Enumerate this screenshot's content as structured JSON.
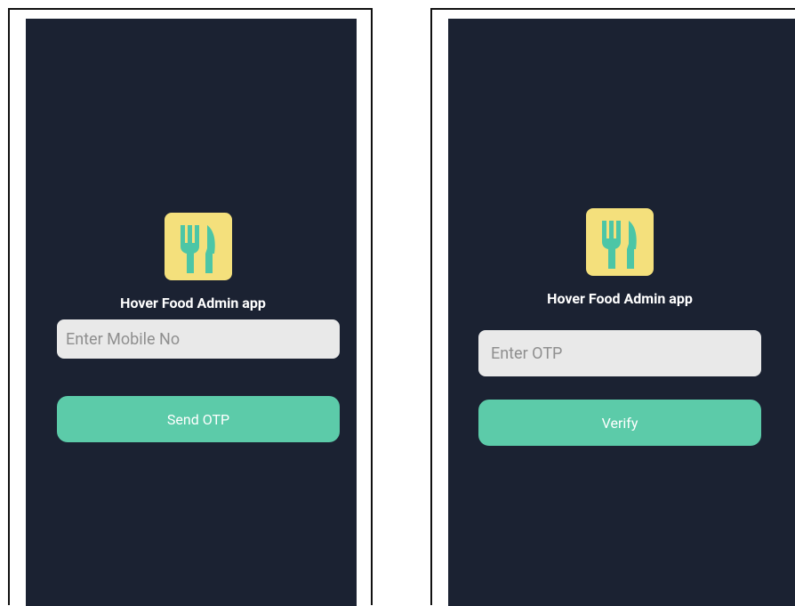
{
  "login_screen": {
    "app_title": "Hover Food Admin app",
    "mobile_placeholder": "Enter Mobile No",
    "send_button_label": "Send OTP"
  },
  "verify_screen": {
    "app_title": "Hover Food Admin app",
    "otp_placeholder": "Enter OTP",
    "verify_button_label": "Verify"
  },
  "colors": {
    "screen_background": "#1b2232",
    "logo_background": "#f4e07c",
    "logo_glyph": "#4cc6a6",
    "accent_button": "#5ccba9",
    "input_background": "#e9e9e9"
  },
  "icons": {
    "logo": "fork-knife-icon"
  }
}
